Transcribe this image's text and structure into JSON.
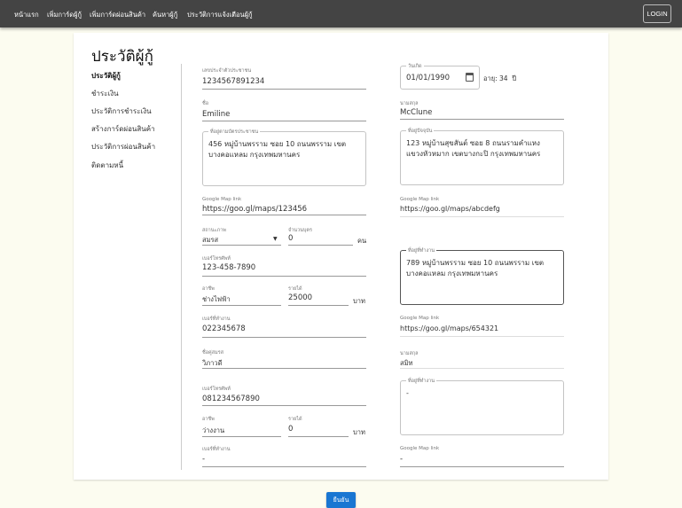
{
  "nav": {
    "items": [
      "หน้าแรก",
      "เพิ่มการ์ดผู้กู้",
      "เพิ่มการ์ดผ่อนสินค้า",
      "ค้นหาผู้กู้",
      "ประวัติการแจ้งเตือนผู้กู้"
    ],
    "login": "LOGIN"
  },
  "page": {
    "title": "ประวัติผู้กู้"
  },
  "sidebar": {
    "items": [
      "ประวัติผู้กู้",
      "ชำระเงิน",
      "ประวัติการชำระเงิน",
      "สร้างการ์ดผ่อนสินค้า",
      "ประวัติการผ่อนสินค้า",
      "ติดตามหนี้"
    ]
  },
  "borrower": {
    "id_label": "เลขประจำตัวประชาชน",
    "id": "1234567891234",
    "first_label": "ชื่อ",
    "first": "Emiline",
    "last_label": "นามสกุล",
    "last": "McClune",
    "dob_label": "วันเกิด",
    "dob": "01/01/1990",
    "age": "อายุ: 34  ปี",
    "id_addr_label": "ที่อยู่ตามบัตรประชาชน",
    "id_addr": "456 หมู่บ้านพรราม ซอย 10 ถนนพรราม เขต บางคอแหลม กรุงเทพมหานคร",
    "cur_addr_label": "ที่อยู่ปัจจุบัน",
    "cur_addr": "123 หมู่บ้านสุขสันต์ ซอย 8 ถนนรามคำแหง แขวงหัวหมาก เขตบางกะปิ กรุงเทพมหานคร",
    "map_label": "Google Map link",
    "map1": "https://goo.gl/maps/123456",
    "map2": "https://goo.gl/maps/abcdefg",
    "status_label": "สถานะภาพ",
    "status": "สมรส",
    "children_label": "จำนวนบุตร",
    "children": "0",
    "children_unit": "คน",
    "phone_label": "เบอร์โทรศัพท์",
    "phone": "123-458-7890",
    "job_label": "อาชีพ",
    "job": "ช่างไฟฟ้า",
    "income_label": "รายได้",
    "income": "25000",
    "income_unit": "บาท",
    "work_phone_label": "เบอร์ที่ทำงาน",
    "work_phone": "022345678",
    "work_addr_label": "ที่อยู่ที่ทำงาน",
    "work_addr": "789 หมู่บ้านพรราม ซอย 10 ถนนพรราม เขต บางคอแหลม กรุงเทพมหานคร",
    "work_map": "https://goo.gl/maps/654321"
  },
  "spouse": {
    "first_label": "ชื่อคู่สมรส",
    "first": "วิภาวดี",
    "last_label": "นามสกุล",
    "last": "สมิท",
    "phone_label": "เบอร์โทรศัพท์",
    "phone": "081234567890",
    "job_label": "อาชีพ",
    "job": "ว่างงาน",
    "income_label": "รายได้",
    "income": "0",
    "income_unit": "บาท",
    "work_phone_label": "เบอร์ที่ทำงาน",
    "work_phone": "-",
    "work_addr_label": "ที่อยู่ที่ทำงาน",
    "work_addr": "-",
    "map_label": "Google Map link",
    "work_map": "-"
  },
  "confirm": "ยืนยัน",
  "colors": {
    "nav": "#444444",
    "primary": "#1976d2",
    "background": "#fcfcf0"
  }
}
